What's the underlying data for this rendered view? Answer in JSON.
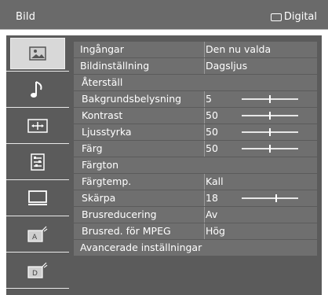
{
  "header": {
    "title": "Bild",
    "source": "Digital"
  },
  "sidebar": {
    "items": [
      {
        "name": "picture-icon",
        "selected": true
      },
      {
        "name": "sound-icon",
        "selected": false
      },
      {
        "name": "screen-icon",
        "selected": false
      },
      {
        "name": "settings-icon",
        "selected": false
      },
      {
        "name": "pc-icon",
        "selected": false
      },
      {
        "name": "analog-tuning-icon",
        "selected": false
      },
      {
        "name": "digital-tuning-icon",
        "selected": false
      }
    ]
  },
  "menu": {
    "rows": [
      {
        "label": "Ingångar",
        "value": "Den nu valda",
        "level": null
      },
      {
        "label": "Bildinställning",
        "value": "Dagsljus",
        "level": null
      },
      {
        "label": "Återställ",
        "value": "",
        "level": null,
        "full": true
      },
      {
        "label": "Bakgrundsbelysning",
        "value": "5",
        "level": 0.5
      },
      {
        "label": "Kontrast",
        "value": "50",
        "level": 0.5
      },
      {
        "label": "Ljusstyrka",
        "value": "50",
        "level": 0.5
      },
      {
        "label": "Färg",
        "value": "50",
        "level": 0.5
      },
      {
        "label": "Färgton",
        "value": "",
        "level": null,
        "full": true
      },
      {
        "label": "Färgtemp.",
        "value": "Kall",
        "level": null
      },
      {
        "label": "Skärpa",
        "value": "18",
        "level": 0.6
      },
      {
        "label": "Brusreducering",
        "value": "Av",
        "level": null
      },
      {
        "label": "Brusred. för MPEG",
        "value": "Hög",
        "level": null
      },
      {
        "label": "Avancerade inställningar",
        "value": "",
        "level": null,
        "full": true
      }
    ]
  },
  "colors": {
    "panel": "#5b5b5b",
    "highlight": "#6f6f6f",
    "topbar": "#6a6a6a",
    "text": "#ffffff"
  }
}
